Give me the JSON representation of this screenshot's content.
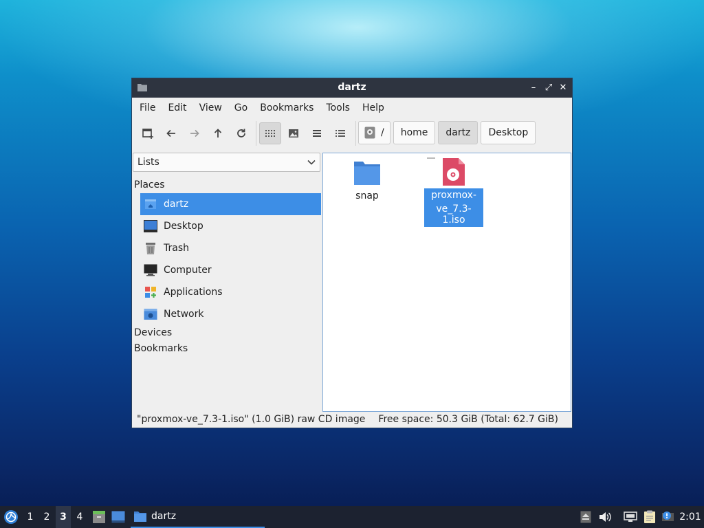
{
  "window": {
    "title": "dartz",
    "minimize_label": "–",
    "maximize_label": "⤢",
    "close_label": "✕"
  },
  "menubar": {
    "items": [
      "File",
      "Edit",
      "View",
      "Go",
      "Bookmarks",
      "Tools",
      "Help"
    ]
  },
  "toolbar": {
    "buttons": [
      "new-tab-icon",
      "back-icon",
      "forward-icon",
      "up-icon",
      "reload-icon",
      "icon-view-icon",
      "thumbnail-view-icon",
      "compact-view-icon",
      "detailed-list-view-icon"
    ],
    "active_view": "icon-view-icon"
  },
  "breadcrumb": {
    "root_label": "/",
    "items": [
      "home",
      "dartz",
      "Desktop"
    ],
    "current": "dartz"
  },
  "sidebar": {
    "mode_select": "Lists",
    "sections": {
      "places": "Places",
      "devices": "Devices",
      "bookmarks": "Bookmarks"
    },
    "places": [
      {
        "label": "dartz",
        "icon": "home-folder-icon",
        "selected": true
      },
      {
        "label": "Desktop",
        "icon": "desktop-icon",
        "selected": false
      },
      {
        "label": "Trash",
        "icon": "trash-icon",
        "selected": false
      },
      {
        "label": "Computer",
        "icon": "computer-icon",
        "selected": false
      },
      {
        "label": "Applications",
        "icon": "applications-icon",
        "selected": false
      },
      {
        "label": "Network",
        "icon": "network-icon",
        "selected": false
      }
    ]
  },
  "files": [
    {
      "name": "snap",
      "icon": "folder-icon",
      "selected": false
    },
    {
      "name_line1": "proxmox-",
      "name_line2": "ve_7.3-1.iso",
      "icon": "disc-image-icon",
      "selected": true
    }
  ],
  "statusbar": {
    "selection_info": "\"proxmox-ve_7.3-1.iso\" (1.0 GiB) raw CD image",
    "free_space": "Free space: 50.3 GiB (Total: 62.7 GiB)"
  },
  "taskbar": {
    "workspaces": [
      "1",
      "2",
      "3",
      "4"
    ],
    "current_workspace": "3",
    "task_label": "dartz",
    "clock": "2:01"
  },
  "colors": {
    "accent": "#3d8ee6",
    "titlebar": "#2e3440",
    "taskbar": "#1c2230",
    "folder": "#4a8bdb",
    "disc": "#d9445f"
  }
}
